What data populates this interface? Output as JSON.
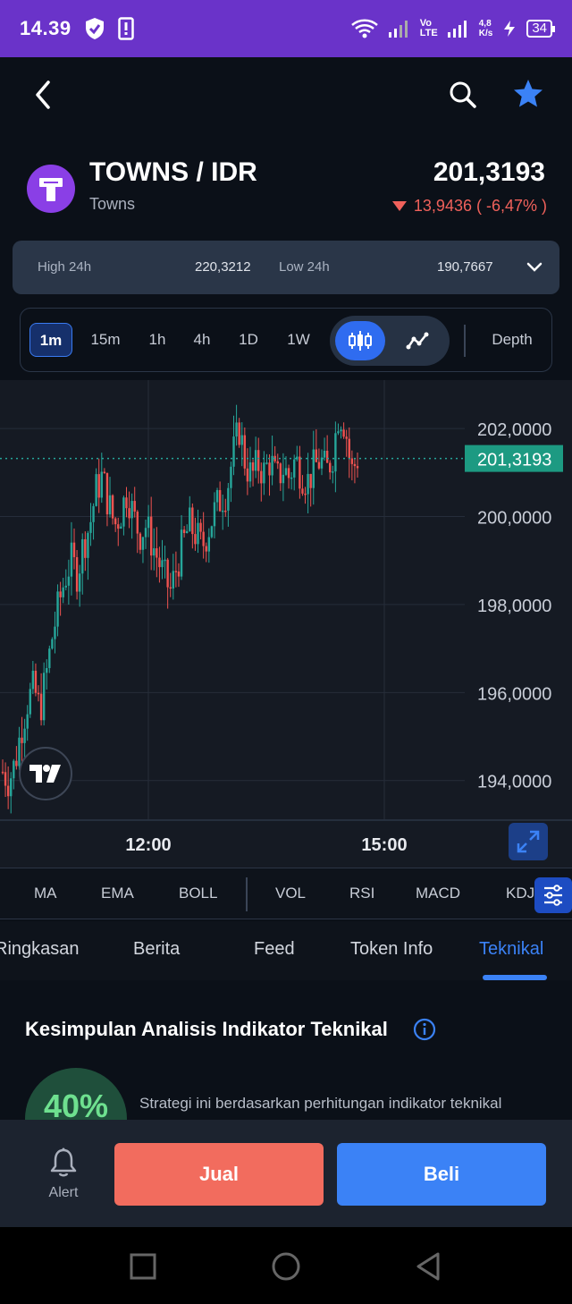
{
  "status_bar": {
    "time": "14.39",
    "net_speed_top": "4,8",
    "net_speed_bottom": "K/s",
    "battery": "34",
    "volte_top": "Vo",
    "volte_bottom": "LTE"
  },
  "header": {
    "pair": "TOWNS / IDR",
    "name": "Towns",
    "price": "201,3193",
    "change": "13,9436 ( -6,47% )"
  },
  "stats": {
    "high_label": "High 24h",
    "high_value": "220,3212",
    "low_label": "Low 24h",
    "low_value": "190,7667"
  },
  "intervals": [
    "1m",
    "15m",
    "1h",
    "4h",
    "1D",
    "1W"
  ],
  "active_interval": "1m",
  "chart_types": [
    "candlestick-icon",
    "line-chart-icon"
  ],
  "depth_label": "Depth",
  "chart_data": {
    "type": "candlestick",
    "y_ticks": [
      "202,0000",
      "200,0000",
      "198,0000",
      "196,0000",
      "194,0000"
    ],
    "x_ticks": [
      "12:00",
      "15:00"
    ],
    "current_price_label": "201,3193",
    "current_price": 201.3193,
    "ylim": [
      193.1,
      203.1
    ],
    "grid": true,
    "colors": {
      "up": "#26a69a",
      "down": "#ef5350",
      "price_line": "#26a69a"
    },
    "close_path": [
      194.2,
      194.0,
      194.4,
      195.2,
      195.8,
      196.1,
      195.6,
      196.4,
      197.3,
      198.0,
      198.6,
      199.0,
      198.7,
      199.4,
      199.8,
      200.6,
      200.9,
      200.3,
      199.8,
      200.1,
      200.6,
      200.0,
      199.6,
      199.8,
      199.4,
      199.0,
      198.6,
      198.3,
      198.9,
      199.4,
      199.8,
      199.6,
      199.3,
      199.7,
      200.1,
      200.4,
      200.6,
      201.4,
      202.0,
      201.2,
      200.9,
      201.2,
      201.0,
      201.3,
      200.8,
      201.1,
      200.9,
      201.3,
      201.0,
      200.8,
      201.1,
      201.3,
      201.0,
      201.4,
      202.4,
      202.1,
      201.0,
      201.3193
    ]
  },
  "indicators": [
    "MA",
    "EMA",
    "BOLL",
    "VOL",
    "RSI",
    "MACD",
    "KDJ"
  ],
  "tabs": [
    "Ringkasan",
    "Berita",
    "Feed",
    "Token Info",
    "Teknikal"
  ],
  "active_tab": "Teknikal",
  "analysis": {
    "title": "Kesimpulan Analisis Indikator Teknikal",
    "percent": "40%",
    "strategy": "Strategi ini berdasarkan perhitungan indikator teknikal"
  },
  "actions": {
    "alert": "Alert",
    "sell": "Jual",
    "buy": "Beli"
  }
}
